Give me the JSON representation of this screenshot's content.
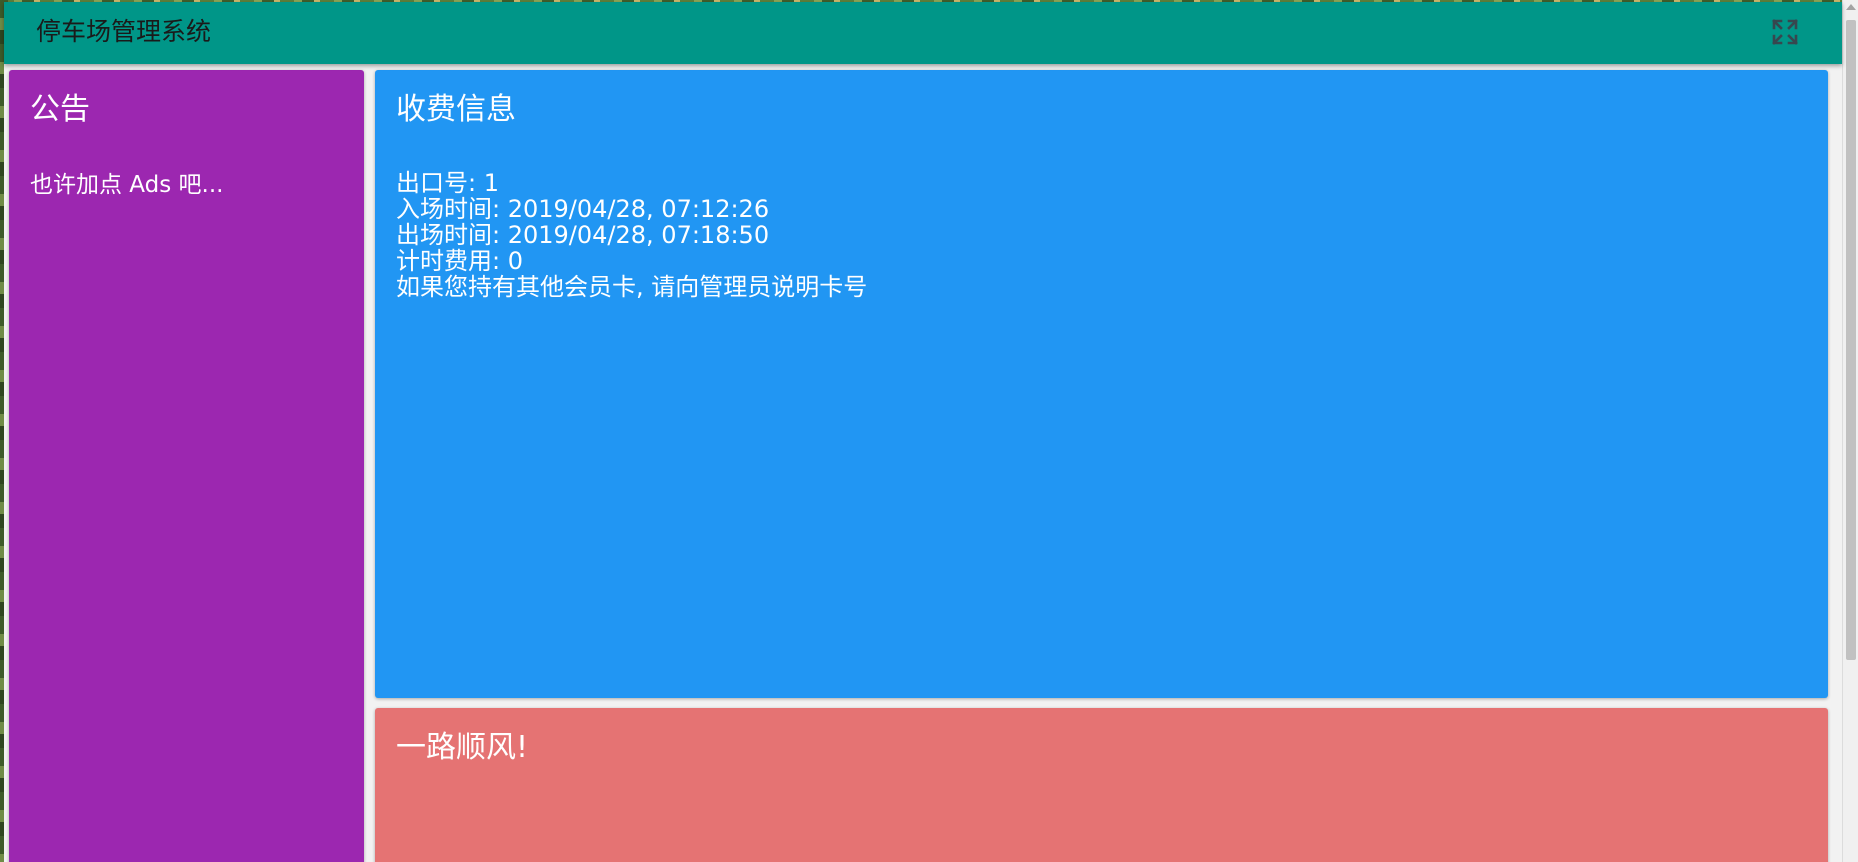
{
  "app": {
    "title": "停车场管理系统",
    "fullscreen_icon": "fullscreen-icon"
  },
  "colors": {
    "appbar": "#009688",
    "announcement_panel": "#9c27b0",
    "fee_panel": "#2196f3",
    "farewell_panel": "#e57373"
  },
  "announcement": {
    "title": "公告",
    "text": "也许加点 Ads 吧..."
  },
  "fee_info": {
    "title": "收费信息",
    "lines": [
      "出口号: 1",
      "入场时间: 2019/04/28, 07:12:26",
      "出场时间: 2019/04/28, 07:18:50",
      "计时费用: 0",
      "如果您持有其他会员卡, 请向管理员说明卡号"
    ]
  },
  "farewell": {
    "title": "一路顺风!"
  }
}
